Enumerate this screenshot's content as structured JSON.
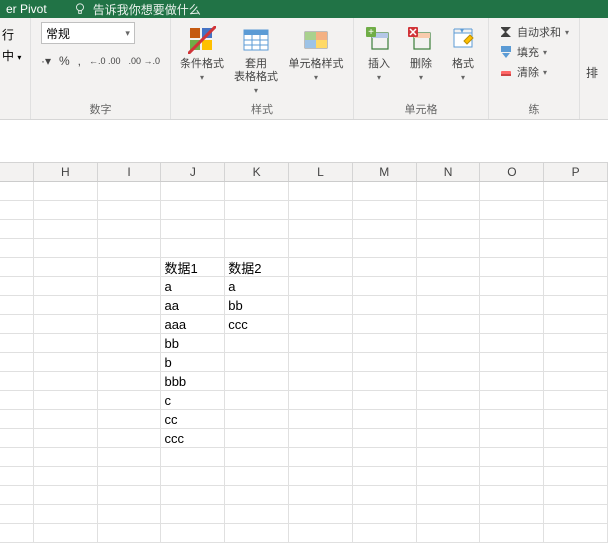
{
  "titlebar": {
    "pivot": "er Pivot",
    "tellme": "告诉我你想要做什么"
  },
  "ribbon": {
    "alignment_partial": {
      "item1": "行",
      "item2": "中"
    },
    "number": {
      "label": "数字",
      "format": "常规",
      "currency_btn": "·",
      "percent_btn": "%",
      "comma_btn": ",",
      "inc_dec": "←.0 .00",
      "dec_dec": ".00 →.0"
    },
    "styles": {
      "label": "样式",
      "cond_fmt": "条件格式",
      "table_fmt_l1": "套用",
      "table_fmt_l2": "表格格式",
      "cell_styles": "单元格样式"
    },
    "cells": {
      "label": "单元格",
      "insert": "插入",
      "delete": "删除",
      "format": "格式"
    },
    "editing": {
      "label": "练",
      "autosum": "自动求和",
      "fill": "填充",
      "clear": "清除"
    },
    "right_cut": "排"
  },
  "columns": [
    "H",
    "I",
    "J",
    "K",
    "L",
    "M",
    "N",
    "O",
    "P"
  ],
  "chart_data": {
    "type": "table",
    "columns": [
      "数据1",
      "数据2"
    ],
    "col_J": [
      "数据1",
      "a",
      "aa",
      "aaa",
      "bb",
      "b",
      "bbb",
      "c",
      "cc",
      "ccc"
    ],
    "col_K": [
      "数据2",
      "a",
      "bb",
      "ccc"
    ]
  }
}
